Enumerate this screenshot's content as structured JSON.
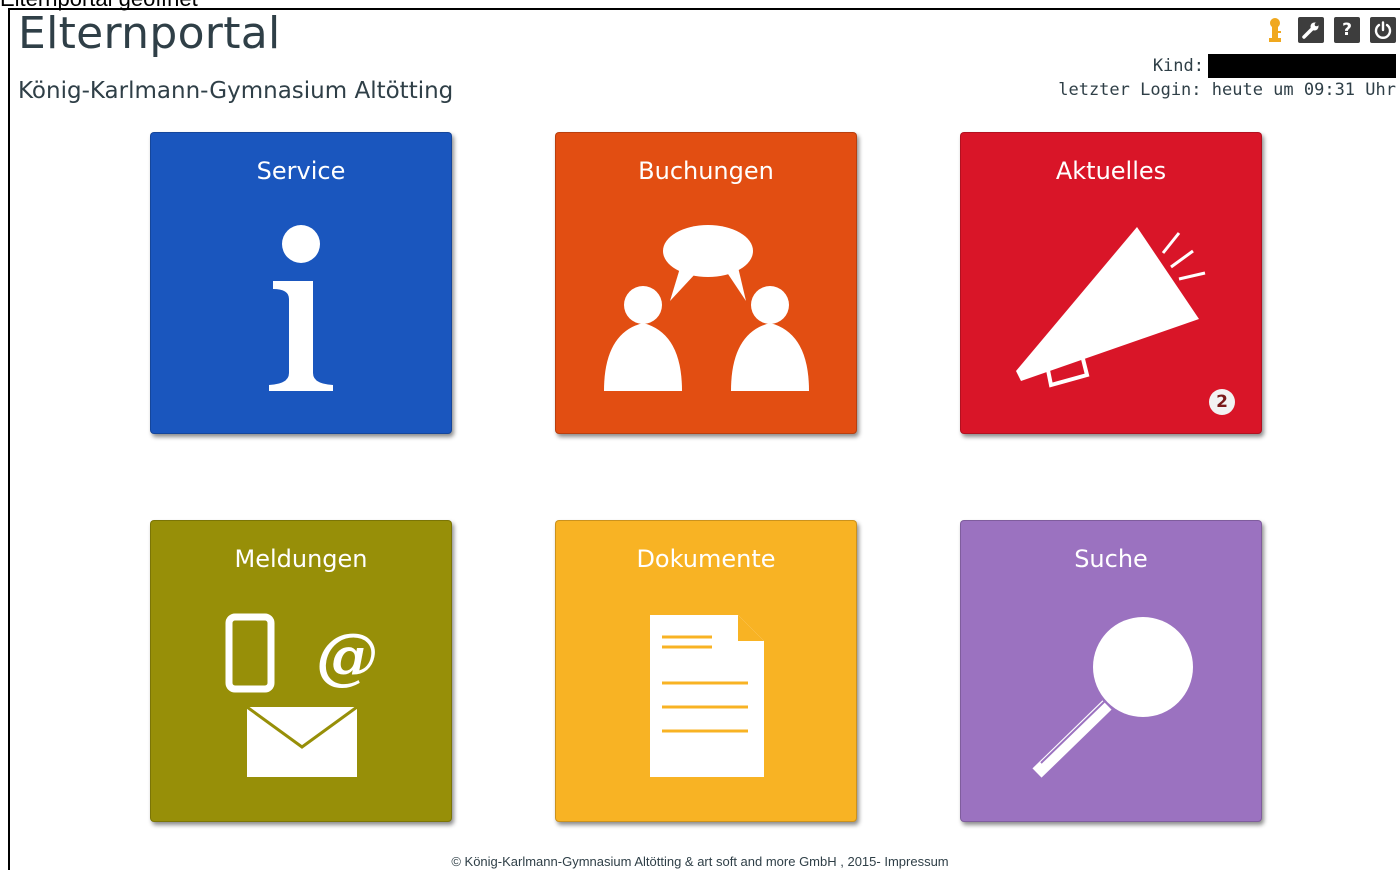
{
  "top_clipped_text": "Elternportal geöffnet",
  "header": {
    "title": "Elternportal",
    "school": "König-Karlmann-Gymnasium Altötting",
    "kind_label": "Kind:",
    "last_login": "letzter Login: heute um 09:31 Uhr"
  },
  "toolbar": {
    "icons": [
      "key-icon",
      "wrench-icon",
      "help-icon",
      "power-icon"
    ],
    "help_glyph": "?"
  },
  "tiles": [
    {
      "label": "Service",
      "color": "#1a56be",
      "icon": "info-icon"
    },
    {
      "label": "Buchungen",
      "color": "#e24e12",
      "icon": "people-talking-icon"
    },
    {
      "label": "Aktuelles",
      "color": "#d91528",
      "icon": "megaphone-icon",
      "badge": "2"
    },
    {
      "label": "Meldungen",
      "color": "#978f08",
      "icon": "phone-mail-at-icon"
    },
    {
      "label": "Dokumente",
      "color": "#f8b324",
      "icon": "document-icon"
    },
    {
      "label": "Suche",
      "color": "#9b72c0",
      "icon": "magnifier-icon"
    }
  ],
  "colors": {
    "key": "#f0a81e",
    "text": "#2f3f47"
  },
  "footer": {
    "copyright": "© König-Karlmann-Gymnasium Altötting & art soft and more GmbH , 2015-",
    "impressum": "Impressum"
  }
}
